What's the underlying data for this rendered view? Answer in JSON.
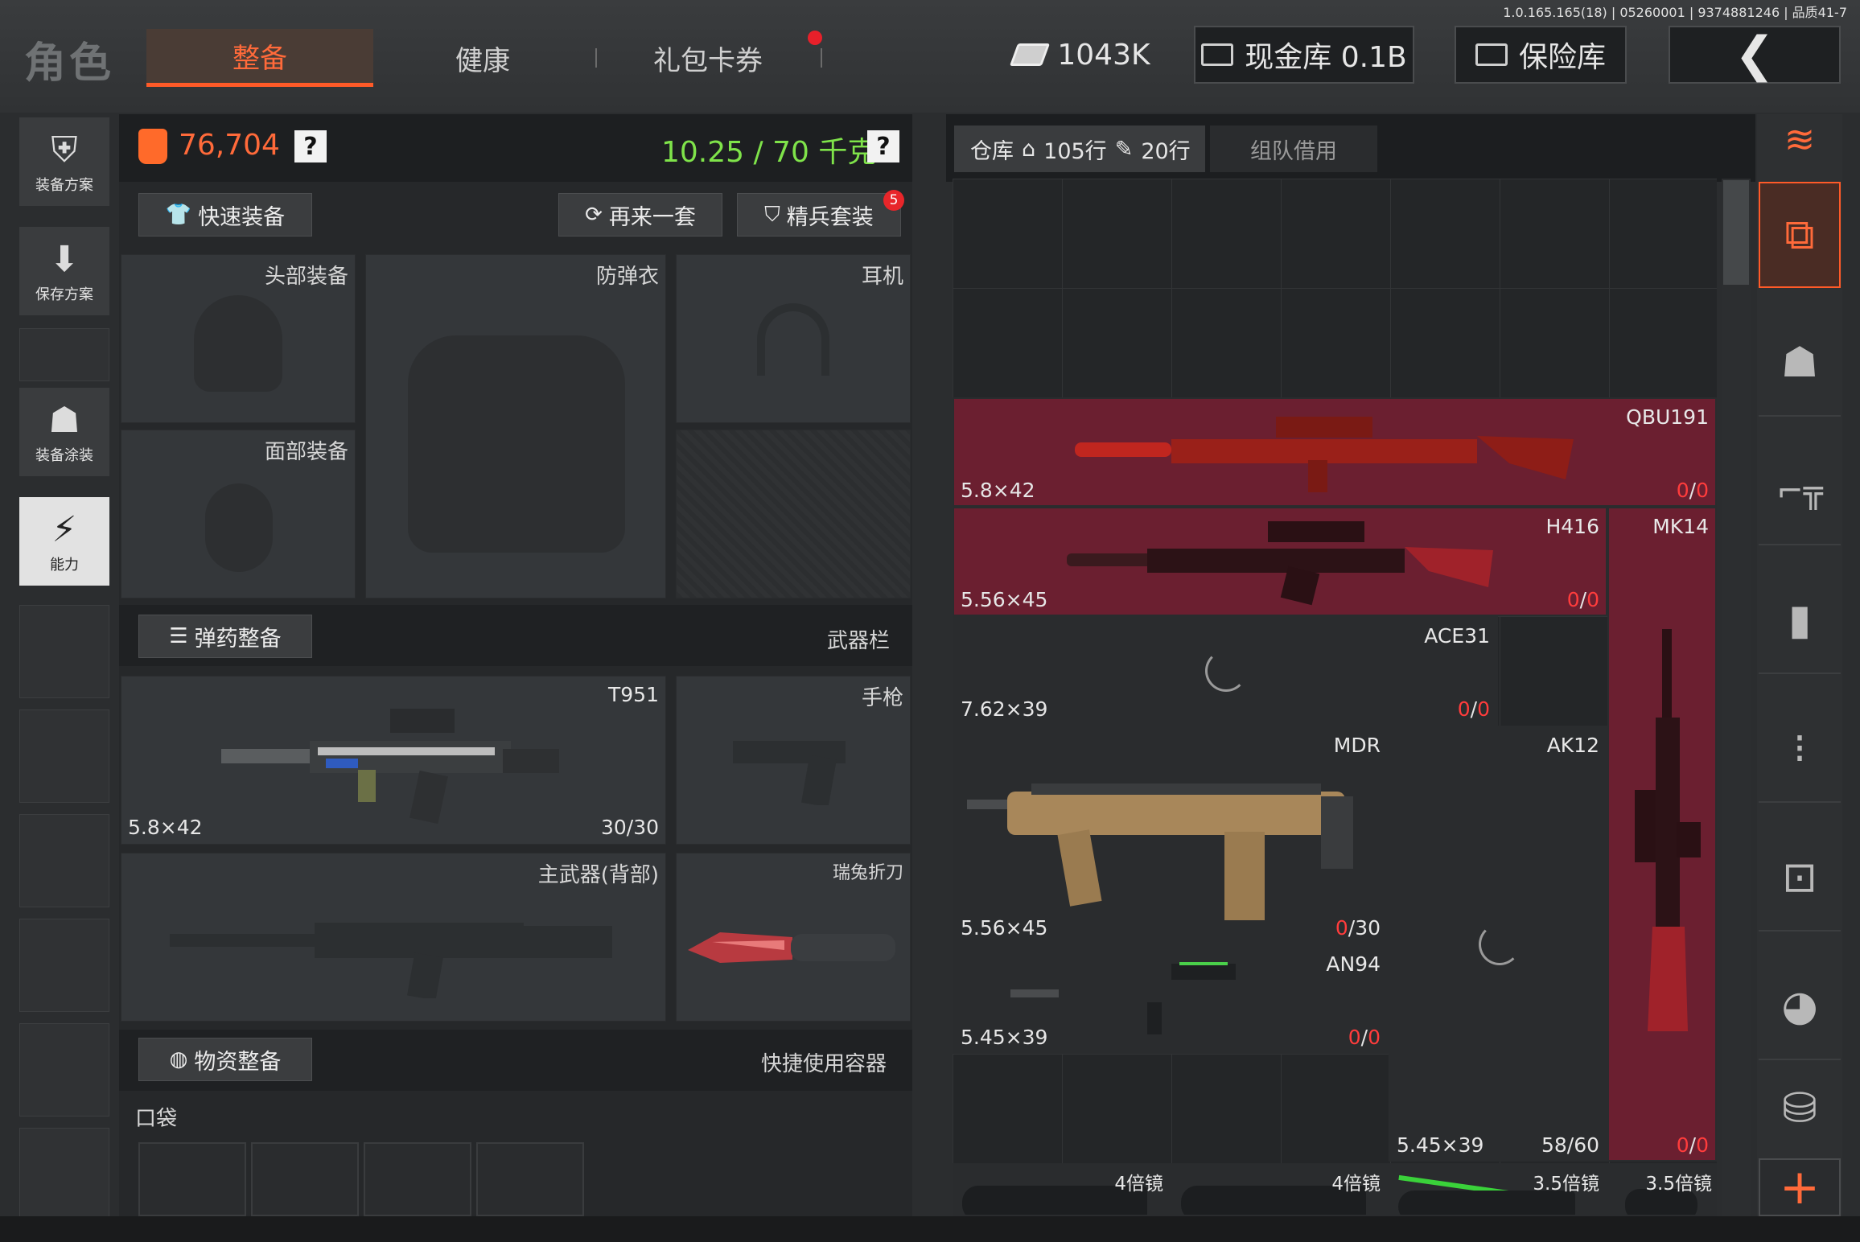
{
  "version": "1.0.165.165(18) | 05260001 | 9374881246 | 品质41-7",
  "header": {
    "title": "角色",
    "tabs": [
      "整备",
      "健康",
      "礼包卡券"
    ],
    "cash": "1043K",
    "vault": "现金库 0.1B",
    "safe": "保险库"
  },
  "left_nav": [
    {
      "label": "装备方案",
      "icon": "vest-plan-icon"
    },
    {
      "label": "保存方案",
      "icon": "download-icon"
    },
    {
      "label": "装备涂装",
      "icon": "helmet-paint-icon"
    },
    {
      "label": "能力",
      "icon": "ability-icon"
    }
  ],
  "loadout": {
    "armor_value": "76,704",
    "weight": "10.25 / 70 千克",
    "help": "?",
    "quick_equip": "快速装备",
    "again": "再来一套",
    "elite": "精兵套装",
    "elite_badge": "5",
    "slots": {
      "head": "头部装备",
      "vest": "防弹衣",
      "headset": "耳机",
      "face": "面部装备"
    },
    "ammo_section": "弹药整备",
    "weapon_bar": "武器栏",
    "primary": {
      "name": "T951",
      "caliber": "5.8×42",
      "ammo": "30/30"
    },
    "pistol": "手枪",
    "back_weapon": "主武器(背部)",
    "knife": "瑞兔折刀",
    "supply_section": "物资整备",
    "quick_container": "快捷使用容器",
    "pocket": "口袋"
  },
  "warehouse": {
    "tab_label": "仓库",
    "rows_home": "105行",
    "rows_extra": "20行",
    "team_tab": "组队借用",
    "items": [
      {
        "name": "QBU191",
        "caliber": "5.8×42",
        "ammo_cur": "0",
        "ammo_max": "0"
      },
      {
        "name": "H416",
        "caliber": "5.56×45",
        "ammo_cur": "0",
        "ammo_max": "0"
      },
      {
        "name": "MK14",
        "caliber": "",
        "ammo_cur": "0",
        "ammo_max": "0"
      },
      {
        "name": "ACE31",
        "caliber": "7.62×39",
        "ammo_cur": "0",
        "ammo_max": "0"
      },
      {
        "name": "MDR",
        "caliber": "5.56×45",
        "ammo_cur": "0",
        "ammo_max": "30"
      },
      {
        "name": "AK12",
        "caliber": "5.45×39",
        "ammo": "58/60"
      },
      {
        "name": "AN94",
        "caliber": "5.45×39",
        "ammo_cur": "0",
        "ammo_max": "0"
      }
    ],
    "scopes": [
      "4倍镜",
      "4倍镜",
      "3.5倍镜",
      "3.5倍镜"
    ]
  },
  "colors": {
    "accent": "#ff5a28",
    "weight_green": "#7fe34a",
    "red_item": "#6b1f30"
  }
}
